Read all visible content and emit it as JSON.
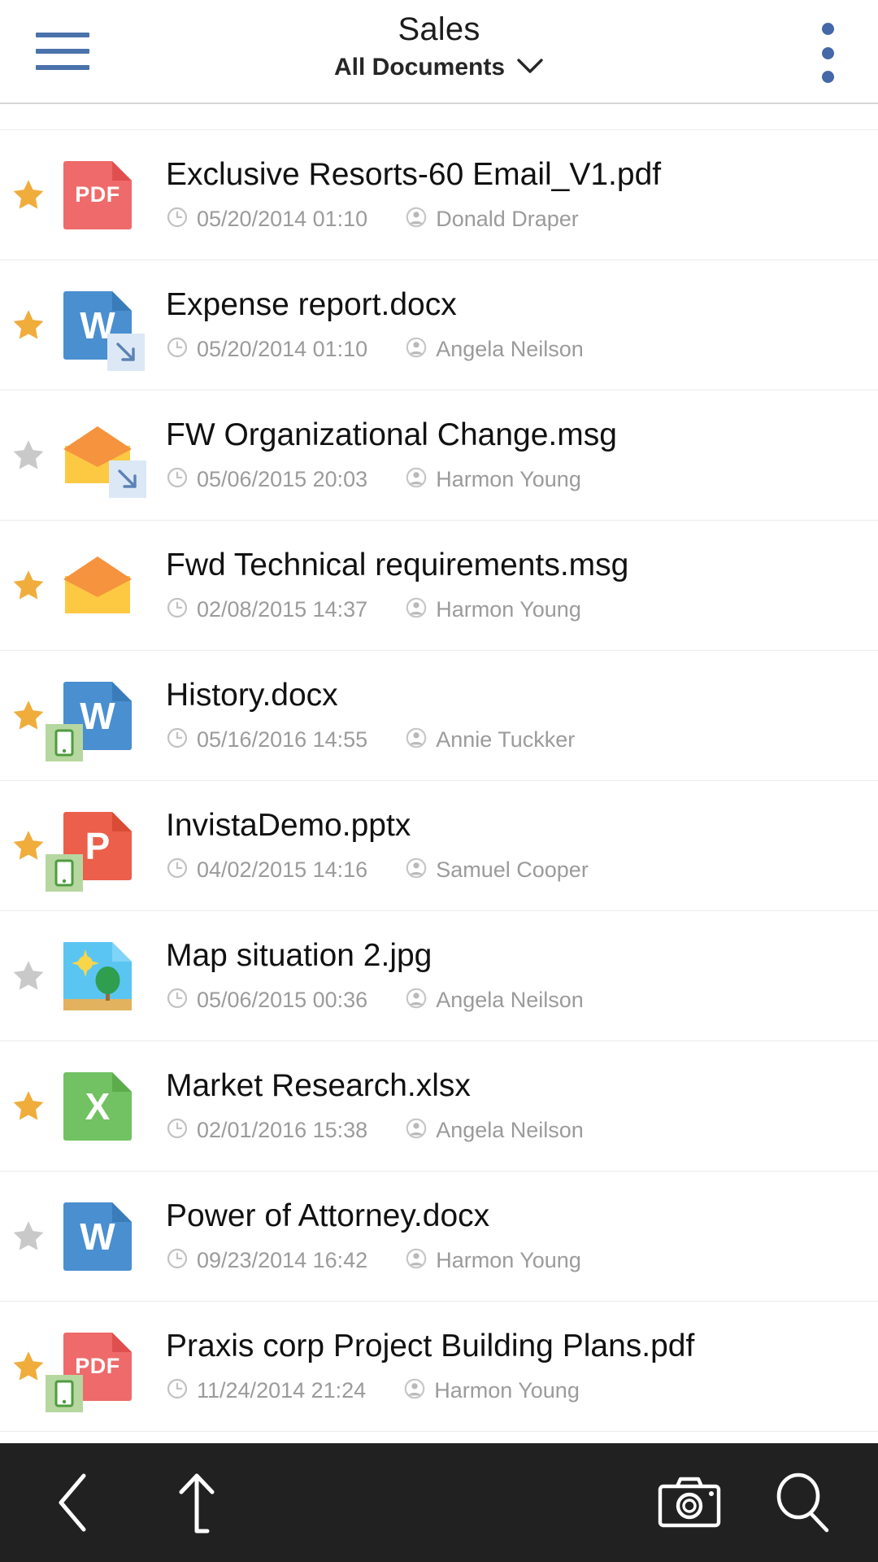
{
  "header": {
    "title": "Sales",
    "subtitle": "All Documents",
    "menu_icon": "hamburger-menu-icon",
    "overflow_icon": "more-vertical-icon",
    "chevron_icon": "chevron-down-icon",
    "accent_color": "#4a72ab"
  },
  "colors": {
    "star_on": "#f0ad3c",
    "star_off": "#c9c9c9",
    "pdf": "#ef6a6a",
    "word": "#4a8fd0",
    "powerpoint": "#ec5f4a",
    "excel": "#72c162",
    "image_sky": "#5bc5f2",
    "envelope_body": "#fdc943",
    "envelope_flap": "#f5933e",
    "badge_sync_bg": "#dce8f5",
    "badge_phone_bg": "#b6d7a0",
    "meta_text": "#9b9b9b",
    "bottombar": "#212121"
  },
  "list": {
    "clock_icon": "clock-icon",
    "author_icon": "person-icon",
    "items": [
      {
        "name": "Exclusive Resorts-60 Email_V1.pdf",
        "date": "05/20/2014 01:10",
        "author": "Donald Draper",
        "kind": "pdf",
        "label": "PDF",
        "starred": true,
        "badge": "none"
      },
      {
        "name": "Expense report.docx",
        "date": "05/20/2014 01:10",
        "author": "Angela Neilson",
        "kind": "word",
        "label": "W",
        "starred": true,
        "badge": "sync"
      },
      {
        "name": "FW Organizational Change.msg",
        "date": "05/06/2015 20:03",
        "author": "Harmon Young",
        "kind": "email",
        "label": "",
        "starred": false,
        "badge": "sync"
      },
      {
        "name": "Fwd Technical requirements.msg",
        "date": "02/08/2015 14:37",
        "author": "Harmon Young",
        "kind": "email",
        "label": "",
        "starred": true,
        "badge": "none"
      },
      {
        "name": "History.docx",
        "date": "05/16/2016 14:55",
        "author": "Annie Tuckker",
        "kind": "word",
        "label": "W",
        "starred": true,
        "badge": "phone"
      },
      {
        "name": "InvistaDemo.pptx",
        "date": "04/02/2015 14:16",
        "author": "Samuel Cooper",
        "kind": "powerpoint",
        "label": "P",
        "starred": true,
        "badge": "phone"
      },
      {
        "name": "Map situation 2.jpg",
        "date": "05/06/2015 00:36",
        "author": "Angela Neilson",
        "kind": "image",
        "label": "",
        "starred": false,
        "badge": "none"
      },
      {
        "name": "Market Research.xlsx",
        "date": "02/01/2016 15:38",
        "author": "Angela Neilson",
        "kind": "excel",
        "label": "X",
        "starred": true,
        "badge": "none"
      },
      {
        "name": "Power of Attorney.docx",
        "date": "09/23/2014 16:42",
        "author": "Harmon Young",
        "kind": "word",
        "label": "W",
        "starred": false,
        "badge": "none"
      },
      {
        "name": "Praxis corp Project Building Plans.pdf",
        "date": "11/24/2014 21:24",
        "author": "Harmon Young",
        "kind": "pdf",
        "label": "PDF",
        "starred": true,
        "badge": "phone"
      }
    ]
  },
  "bottombar": {
    "buttons": [
      {
        "icon": "back-chevron-icon",
        "name": "back-button"
      },
      {
        "icon": "upload-arrow-icon",
        "name": "upload-button"
      },
      {
        "icon": "camera-icon",
        "name": "camera-button"
      },
      {
        "icon": "search-icon",
        "name": "search-button"
      }
    ]
  }
}
